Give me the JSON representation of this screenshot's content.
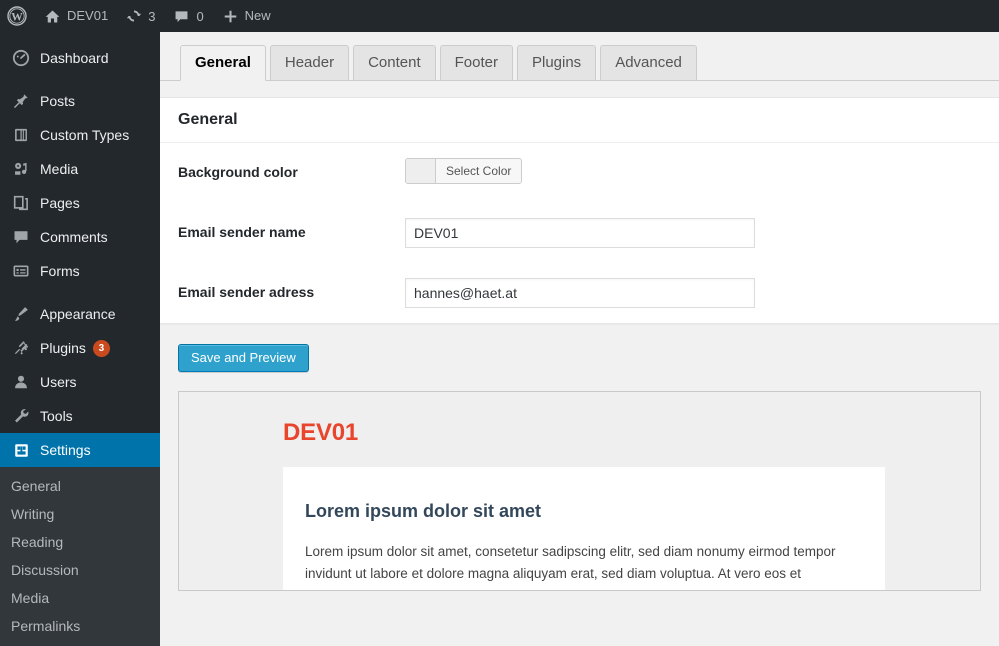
{
  "adminbar": {
    "wp_logo": "wordpress-logo-icon",
    "site_name": "DEV01",
    "home_icon": "home-icon",
    "updates_icon": "updates-icon",
    "updates_count": "3",
    "comments_icon": "comment-bubble-icon",
    "comments_count": "0",
    "new_icon": "plus-icon",
    "new_label": "New"
  },
  "sidebar": {
    "items": [
      {
        "label": "Dashboard",
        "icon": "dashboard-icon",
        "badge": ""
      },
      {
        "label": "Posts",
        "icon": "pin-icon",
        "badge": ""
      },
      {
        "label": "Custom Types",
        "icon": "book-icon",
        "badge": ""
      },
      {
        "label": "Media",
        "icon": "media-icon",
        "badge": ""
      },
      {
        "label": "Pages",
        "icon": "pages-icon",
        "badge": ""
      },
      {
        "label": "Comments",
        "icon": "comment-bubble-icon",
        "badge": ""
      },
      {
        "label": "Forms",
        "icon": "forms-icon",
        "badge": ""
      },
      {
        "label": "Appearance",
        "icon": "paintbrush-icon",
        "badge": ""
      },
      {
        "label": "Plugins",
        "icon": "plug-icon",
        "badge": "3"
      },
      {
        "label": "Users",
        "icon": "user-icon",
        "badge": ""
      },
      {
        "label": "Tools",
        "icon": "wrench-icon",
        "badge": ""
      },
      {
        "label": "Settings",
        "icon": "settings-icon",
        "badge": ""
      }
    ],
    "current_item": "Settings",
    "submenu": [
      {
        "label": "General"
      },
      {
        "label": "Writing"
      },
      {
        "label": "Reading"
      },
      {
        "label": "Discussion"
      },
      {
        "label": "Media"
      },
      {
        "label": "Permalinks"
      }
    ]
  },
  "tabs": [
    {
      "label": "General",
      "active": true
    },
    {
      "label": "Header",
      "active": false
    },
    {
      "label": "Content",
      "active": false
    },
    {
      "label": "Footer",
      "active": false
    },
    {
      "label": "Plugins",
      "active": false
    },
    {
      "label": "Advanced",
      "active": false
    }
  ],
  "panel": {
    "title": "General",
    "fields": [
      {
        "label": "Background color",
        "type": "color",
        "button_label": "Select Color",
        "swatch": "#eeeeee"
      },
      {
        "label": "Email sender name",
        "type": "text",
        "value": "DEV01",
        "placeholder": ""
      },
      {
        "label": "Email sender adress",
        "type": "text",
        "value": "hannes@haet.at",
        "placeholder": ""
      }
    ]
  },
  "submit": {
    "label": "Save and Preview"
  },
  "preview": {
    "title": "DEV01",
    "title_color": "#e8452c",
    "heading": "Lorem ipsum dolor sit amet",
    "body": "Lorem ipsum dolor sit amet, consetetur sadipscing elitr, sed diam nonumy eirmod tempor invidunt ut labore et dolore magna aliquyam erat, sed diam voluptua. At vero eos et"
  },
  "colors": {
    "adminbar_bg": "#23282d",
    "sidebar_bg": "#23282d",
    "submenu_bg": "#32373c",
    "current_highlight": "#0073aa",
    "badge": "#ca4a1f",
    "primary_button": "#2ea2cc",
    "content_bg": "#f1f1f1"
  }
}
